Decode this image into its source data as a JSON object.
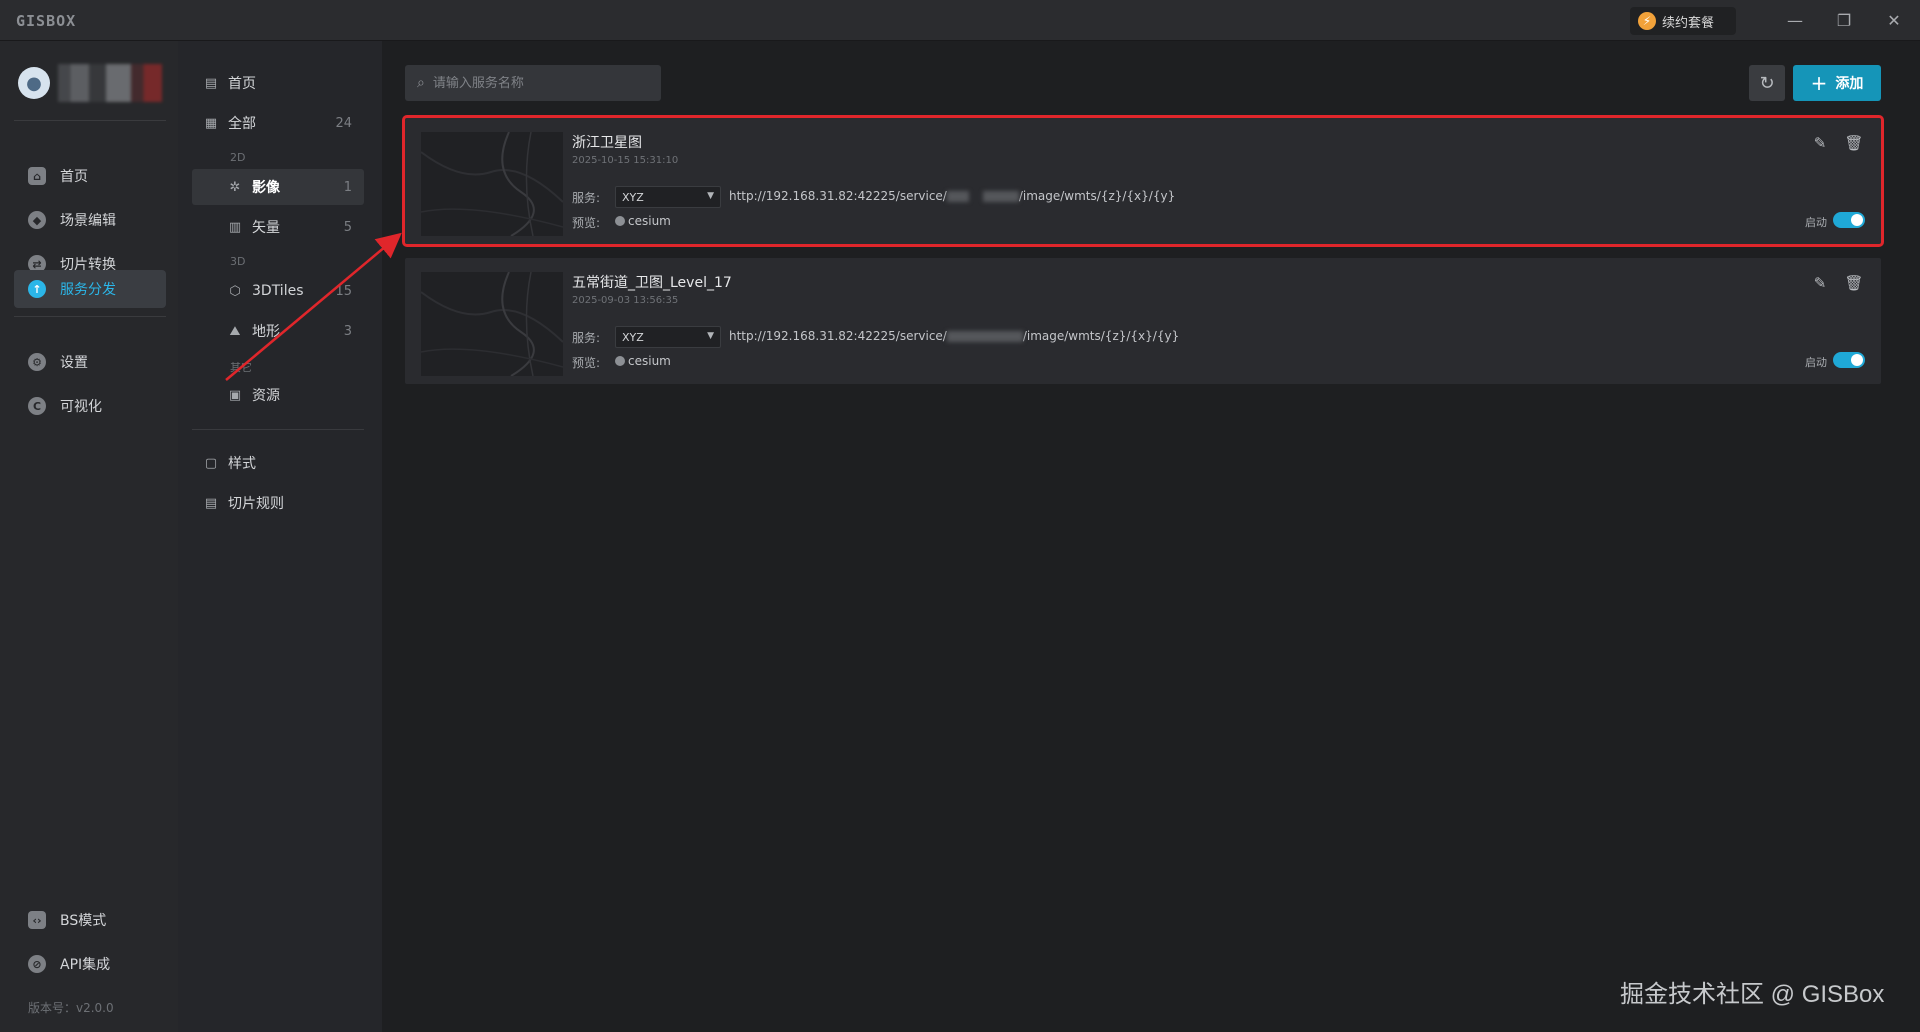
{
  "app": {
    "logo": "GISBOX",
    "renew_label": "续约套餐"
  },
  "window_controls": {
    "minimize": "—",
    "restore": "❐",
    "close": "✕"
  },
  "leftnav": {
    "items": [
      {
        "label": "首页",
        "icon": "home-icon"
      },
      {
        "label": "场景编辑",
        "icon": "cube-icon"
      },
      {
        "label": "切片转换",
        "icon": "convert-icon"
      },
      {
        "label": "服务分发",
        "icon": "upload-icon",
        "active": true
      },
      {
        "label": "设置",
        "icon": "gear-icon"
      },
      {
        "label": "可视化",
        "icon": "visual-icon"
      },
      {
        "label": "BS模式",
        "icon": "code-icon"
      },
      {
        "label": "API集成",
        "icon": "api-icon"
      }
    ],
    "version": "版本号：v2.0.0"
  },
  "categories": {
    "home": {
      "label": "首页"
    },
    "all": {
      "label": "全部",
      "count": "24"
    },
    "group_2d": "2D",
    "image": {
      "label": "影像",
      "count": "1"
    },
    "vector": {
      "label": "矢量",
      "count": "5"
    },
    "group_3d": "3D",
    "tiles3d": {
      "label": "3DTiles",
      "count": "15"
    },
    "terrain": {
      "label": "地形",
      "count": "3"
    },
    "group_other": "其它",
    "resource": {
      "label": "资源"
    },
    "style": {
      "label": "样式"
    },
    "tile_rule": {
      "label": "切片规则"
    }
  },
  "toolbar": {
    "search_placeholder": "请输入服务名称",
    "add_label": "添加"
  },
  "services": [
    {
      "title": "浙江卫星图",
      "date": "2025-10-15 15:31:10",
      "service_label": "服务:",
      "service_type": "XYZ",
      "url_prefix": "http://192.168.31.82:42225/service/",
      "url_suffix": "/image/wmts/{z}/{x}/{y}",
      "preview_label": "预览:",
      "preview_link": "cesium",
      "switch_label": "启动"
    },
    {
      "title": "五常街道_卫图_Level_17",
      "date": "2025-09-03 13:56:35",
      "service_label": "服务:",
      "service_type": "XYZ",
      "url_prefix": "http://192.168.31.82:42225/service/",
      "url_suffix": "/image/wmts/{z}/{x}/{y}",
      "preview_label": "预览:",
      "preview_link": "cesium",
      "switch_label": "启动"
    }
  ],
  "watermark": "掘金技术社区 @ GISBox",
  "colors": {
    "accent": "#1595b8",
    "highlight": "#e0262b",
    "switch": "#1fa8d6"
  }
}
